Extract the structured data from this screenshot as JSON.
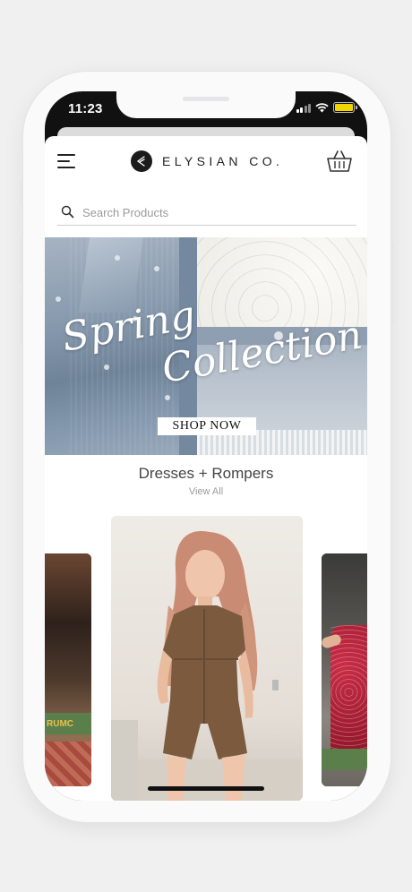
{
  "status_bar": {
    "time": "11:23",
    "battery_color": "#f2d500"
  },
  "header": {
    "menu_icon": "hamburger-icon",
    "brand_name": "ELYSIAN CO.",
    "cart_icon": "basket-icon"
  },
  "search": {
    "placeholder": "Search Products",
    "value": "",
    "icon": "search-icon"
  },
  "hero": {
    "title_line1": "Spring",
    "title_line2": "Collection",
    "cta_label": "SHOP NOW"
  },
  "category": {
    "title": "Dresses + Rompers",
    "view_all_label": "View All"
  },
  "carousel": {
    "left_sign_text": "RUMC",
    "items": [
      "product-image-left",
      "product-image-center",
      "product-image-right"
    ]
  }
}
